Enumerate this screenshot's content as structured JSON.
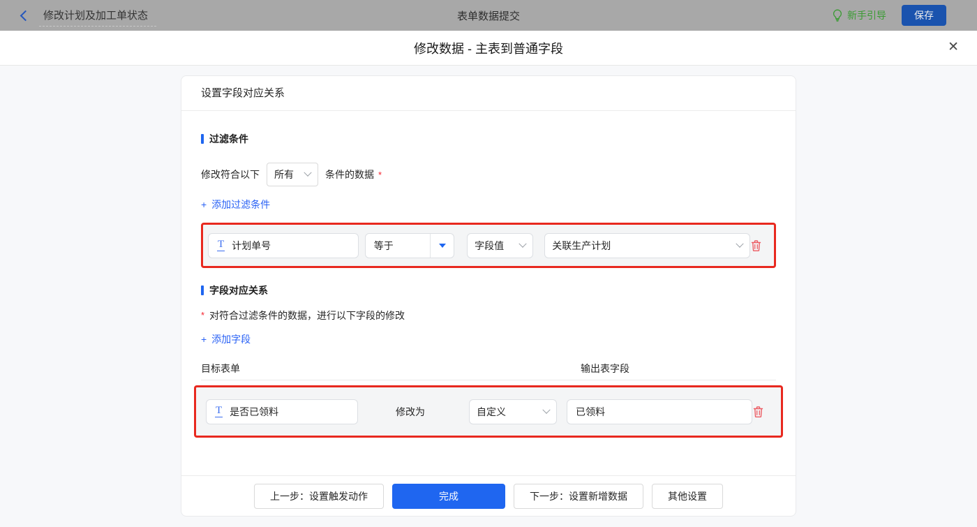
{
  "topbar": {
    "back_title": "修改计划及加工单状态",
    "center_title": "表单数据提交",
    "guide_label": "新手引导",
    "save_label": "保存"
  },
  "modal": {
    "title": "修改数据 - 主表到普通字段",
    "close_glyph": "✕"
  },
  "card": {
    "header": "设置字段对应关系",
    "filter_section": {
      "title": "过滤条件",
      "match_prefix": "修改符合以下",
      "match_select_value": "所有",
      "match_suffix": "条件的数据",
      "required_mark": "*",
      "add_plus": "+",
      "add_label": "添加过滤条件",
      "row": {
        "field_icon": "T",
        "field": "计划单号",
        "operator": "等于",
        "value_type": "字段值",
        "value": "关联生产计划"
      }
    },
    "mapping_section": {
      "title": "字段对应关系",
      "required_mark": "*",
      "description": "对符合过滤条件的数据，进行以下字段的修改",
      "add_plus": "+",
      "add_label": "添加字段",
      "col_target": "目标表单",
      "col_output": "输出表字段",
      "row": {
        "field_icon": "T",
        "field": "是否已领料",
        "modify_label": "修改为",
        "value_type": "自定义",
        "value": "已领料"
      }
    }
  },
  "footer": {
    "buttons": [
      {
        "label": "上一步：设置触发动作"
      },
      {
        "label": "完成"
      },
      {
        "label": "下一步：设置新增数据"
      },
      {
        "label": "其他设置"
      }
    ]
  },
  "colors": {
    "primary_blue": "#1f66f0",
    "annotation_red": "#e8291f",
    "trash_red": "#ec5b62",
    "guide_green": "#3b9b34",
    "topbar_gray": "#a8a8a8"
  }
}
